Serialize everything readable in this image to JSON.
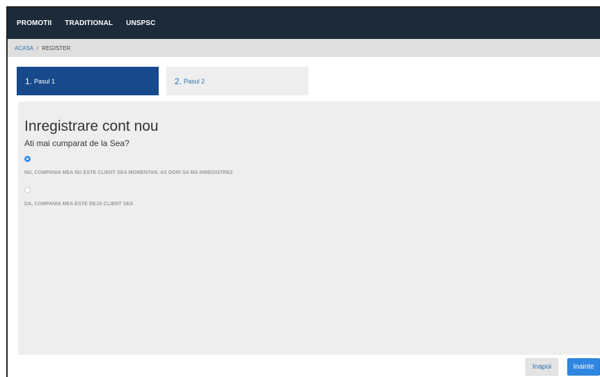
{
  "topnav": {
    "items": [
      "PROMOTII",
      "TRADITIONAL",
      "UNSPSC"
    ]
  },
  "breadcrumb": {
    "home": "ACASA",
    "separator": "/",
    "current": "REGISTER"
  },
  "steps": [
    {
      "num": "1.",
      "label": "Pasul 1",
      "active": true
    },
    {
      "num": "2.",
      "label": "Pasul 2",
      "active": false
    }
  ],
  "form": {
    "title": "Inregistrare cont nou",
    "question": "Ati mai cumparat de la Sea?",
    "options": [
      {
        "label": "NU, COMPANIA MEA NU ESTE CLIENT SEA MOMENTAN. AS DORI SA MA INREGISTREZ",
        "checked": true
      },
      {
        "label": "DA, COMPANIA MEA ESTE DEJA CLIENT SEA",
        "checked": false
      }
    ]
  },
  "buttons": {
    "back": "Inapoi",
    "next": "Inainte"
  },
  "colors": {
    "navbar": "#1c2a3a",
    "active_step": "#17498c",
    "primary_button": "#2f86e0",
    "link": "#2a6fb0"
  }
}
